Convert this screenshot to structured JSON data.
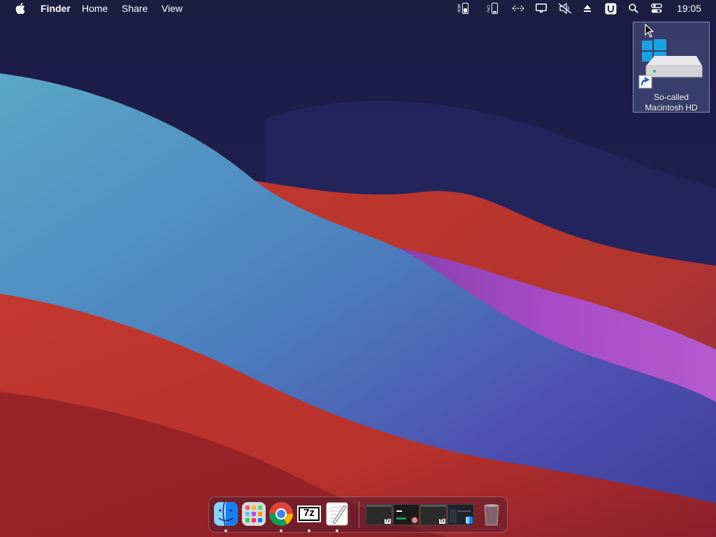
{
  "menubar": {
    "apple_icon": "apple-logo",
    "app_name": "Finder",
    "menus": [
      "Home",
      "Share",
      "View"
    ],
    "status_icons": [
      "mem-icon",
      "cpu-icon",
      "network-arrows-icon",
      "display-icon",
      "mute-icon",
      "eject-icon",
      "u-app-icon",
      "search-icon",
      "control-center-icon"
    ],
    "mem_label": "MEM",
    "cpu_label": "CPU",
    "clock": "19:05"
  },
  "desktop": {
    "icons": [
      {
        "label": "So-called Macintosh HD",
        "icon": "hard-drive-windows-shortcut-icon"
      }
    ]
  },
  "dock": {
    "apps": [
      {
        "name": "Finder",
        "icon": "finder-icon",
        "running": true
      },
      {
        "name": "Launchpad",
        "icon": "launchpad-icon",
        "running": false
      },
      {
        "name": "Chrome",
        "icon": "chrome-icon",
        "running": true
      },
      {
        "name": "7-Zip",
        "icon": "7zip-icon",
        "running": true,
        "label": "7z"
      },
      {
        "name": "TextEdit",
        "icon": "textedit-icon",
        "running": true
      }
    ],
    "minimized": [
      {
        "icon": "7zip-badge-icon",
        "badge": "7z"
      },
      {
        "icon": "chrome-badge-icon"
      },
      {
        "icon": "7zip-badge-icon",
        "badge": "7z"
      },
      {
        "icon": "finder-badge-icon"
      }
    ],
    "trash": {
      "icon": "trash-icon"
    }
  },
  "colors": {
    "sky": "#1d1d49",
    "teal_wave": "#4f9fc2",
    "red_wave": "#c0362e",
    "purple_glow": "#a54ed6"
  }
}
